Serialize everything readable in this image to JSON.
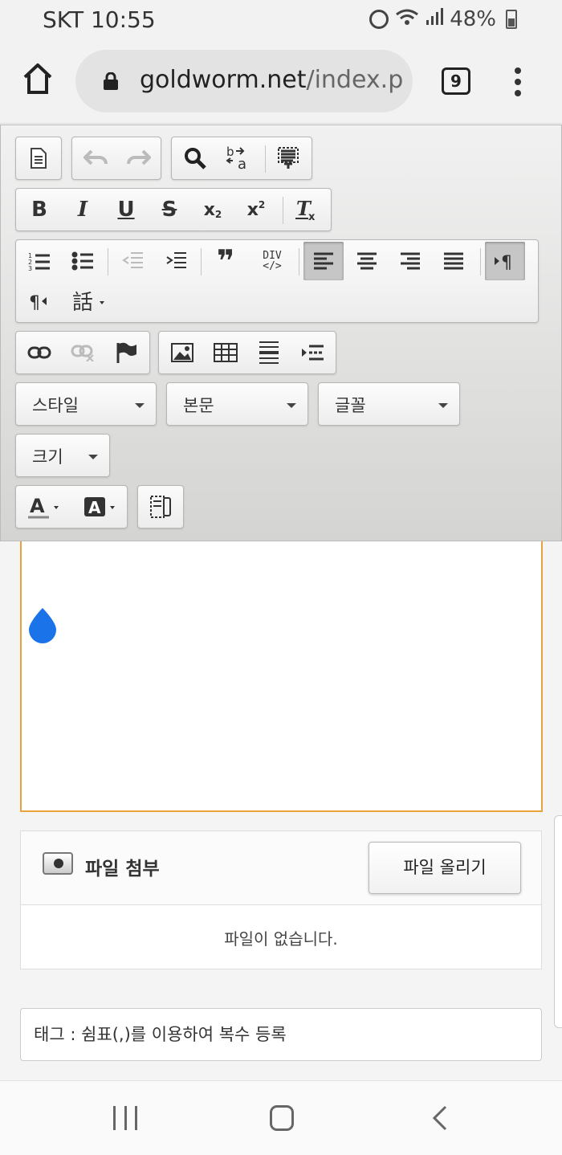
{
  "status_bar": {
    "carrier": "SKT",
    "time": "10:55",
    "battery": "48%"
  },
  "browser": {
    "url_host": "goldworm.net",
    "url_path": "/index.p",
    "tab_count": "9"
  },
  "toolbar": {
    "row4_text": {
      "subscript": "x",
      "superscript": "x",
      "div": "DIV",
      "quote": "❞"
    },
    "combos": {
      "style": "스타일",
      "format": "본문",
      "font": "글꼴",
      "size": "크기"
    }
  },
  "attach": {
    "title": "파일 첨부",
    "upload_label": "파일 올리기",
    "empty_text": "파일이 없습니다."
  },
  "tags": {
    "placeholder": "태그 : 쉼표(,)를 이용하여 복수 등록"
  },
  "colors": {
    "accent_border": "#e8a33c",
    "cursor_blue": "#1a73e8"
  }
}
